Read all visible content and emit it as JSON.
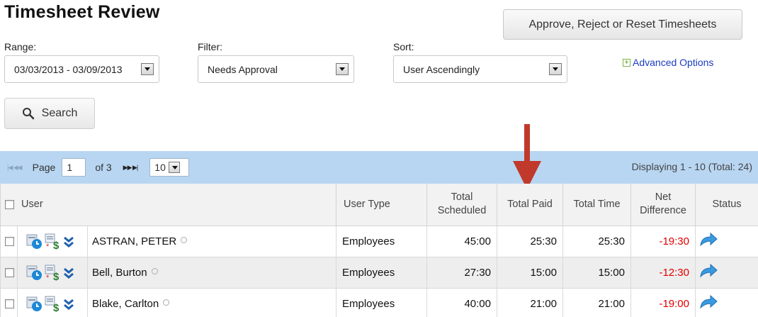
{
  "page": {
    "title": "Timesheet Review"
  },
  "actions": {
    "approve_reject_reset_label": "Approve, Reject or Reset Timesheets"
  },
  "filters": {
    "range": {
      "label": "Range:",
      "value": "03/03/2013 - 03/09/2013"
    },
    "filter": {
      "label": "Filter:",
      "value": "Needs Approval"
    },
    "sort": {
      "label": "Sort:",
      "value": "User Ascendingly"
    },
    "advanced_options_label": "Advanced Options",
    "search_label": "Search"
  },
  "pager": {
    "page_label": "Page",
    "current_page": "1",
    "of_label": "of 3",
    "page_size": "10",
    "displaying_text": "Displaying 1 - 10  (Total: 24)"
  },
  "table": {
    "headers": {
      "user": "User",
      "user_type": "User Type",
      "total_scheduled_line1": "Total",
      "total_scheduled_line2": "Scheduled",
      "total_paid": "Total Paid",
      "total_time": "Total Time",
      "net_difference_line1": "Net",
      "net_difference_line2": "Difference",
      "status": "Status"
    },
    "rows": [
      {
        "name": "ASTRAN, PETER",
        "user_type": "Employees",
        "total_scheduled": "45:00",
        "total_paid": "25:30",
        "total_time": "25:30",
        "net_difference": "-19:30"
      },
      {
        "name": "Bell, Burton",
        "user_type": "Employees",
        "total_scheduled": "27:30",
        "total_paid": "15:00",
        "total_time": "15:00",
        "net_difference": "-12:30"
      },
      {
        "name": "Blake, Carlton",
        "user_type": "Employees",
        "total_scheduled": "40:00",
        "total_paid": "21:00",
        "total_time": "21:00",
        "net_difference": "-19:00"
      }
    ]
  },
  "colors": {
    "pager_bg": "#b8d6f2",
    "negative": "#e00000",
    "annotation_arrow": "#c0392b",
    "link": "#1a3dc0"
  }
}
